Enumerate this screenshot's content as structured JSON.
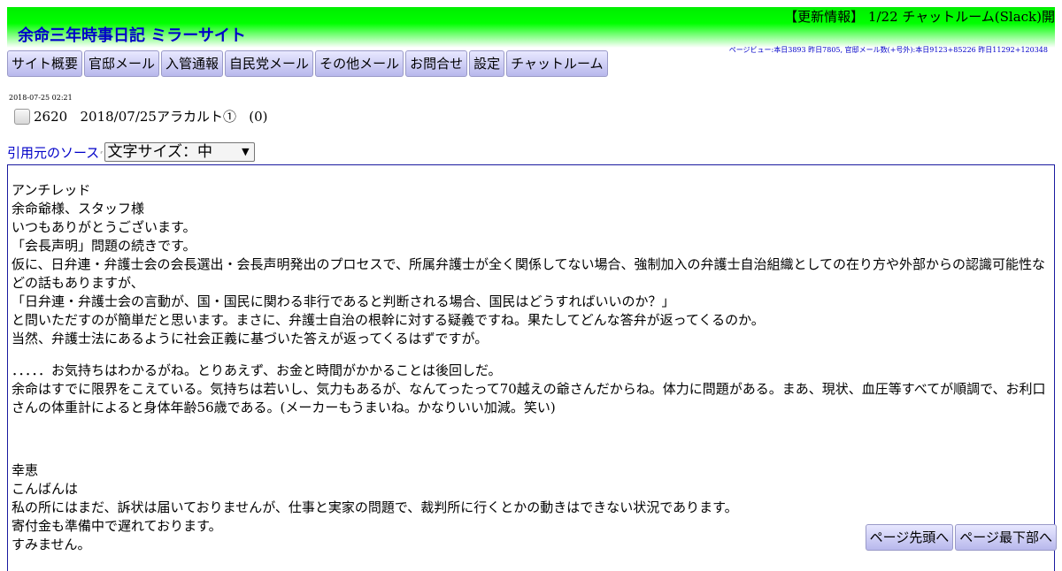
{
  "header": {
    "news": "【更新情報】 1/22 チャットルーム(Slack)開",
    "title": "余命三年時事日記 ミラーサイト",
    "counter": "ページビュー:本日3893 昨日7805, 官邸メール数(+号外):本日9123+85226 昨日11292+120348"
  },
  "nav": {
    "items": [
      "サイト概要",
      "官邸メール",
      "入管通報",
      "自民党メール",
      "その他メール",
      "お問合せ",
      "設定",
      "チャットルーム"
    ]
  },
  "post": {
    "datetime": "2018-07-25 02:21",
    "number": "2620",
    "title": "2018/07/25アラカルト①",
    "comment_count": "(0)"
  },
  "source": {
    "link_label": "引用元のソース",
    "font_size_select": "文字サイズ：中"
  },
  "content": {
    "block1": [
      "アンチレッド",
      "余命爺様、スタッフ様",
      "いつもありがとうございます。",
      "「会長声明」問題の続きです。",
      "仮に、日弁連・弁護士会の会長選出・会長声明発出のプロセスで、所属弁護士が全く関係してない場合、強制加入の弁護士自治組織としての在り方や外部からの認識可能性などの話もありますが、",
      "「日弁連・弁護士会の言動が、国・国民に関わる非行であると判断される場合、国民はどうすればいいのか？」",
      "と問いただすのが簡単だと思います。まさに、弁護士自治の根幹に対する疑義ですね。果たしてどんな答弁が返ってくるのか。",
      "当然、弁護士法にあるように社会正義に基づいた答えが返ってくるはずですが。"
    ],
    "block2": [
      "．．．．．お気持ちはわかるがね。とりあえず、お金と時間がかかることは後回しだ。",
      "余命はすでに限界をこえている。気持ちは若いし、気力もあるが、なんてったって70越えの爺さんだからね。体力に問題がある。まあ、現状、血圧等すべてが順調で、お利口さんの体重計によると身体年齢56歳である。(メーカーもうまいね。かなりいい加減。笑い)"
    ],
    "block3": [
      "幸恵",
      "こんばんは",
      "私の所にはまだ、訴状は届いておりませんが、仕事と実家の問題で、裁判所に行くとかの動きはできない状況であります。",
      "寄付金も準備中で遅れております。",
      "すみません。"
    ]
  },
  "floating": {
    "top_label": "ページ先頭へ",
    "bottom_label": "ページ最下部へ"
  },
  "colors": {
    "banner_green": "#00ee00",
    "title_blue": "#0000c8",
    "button_bg": "#c8c8f0",
    "border_navy": "#1a1aa0"
  }
}
